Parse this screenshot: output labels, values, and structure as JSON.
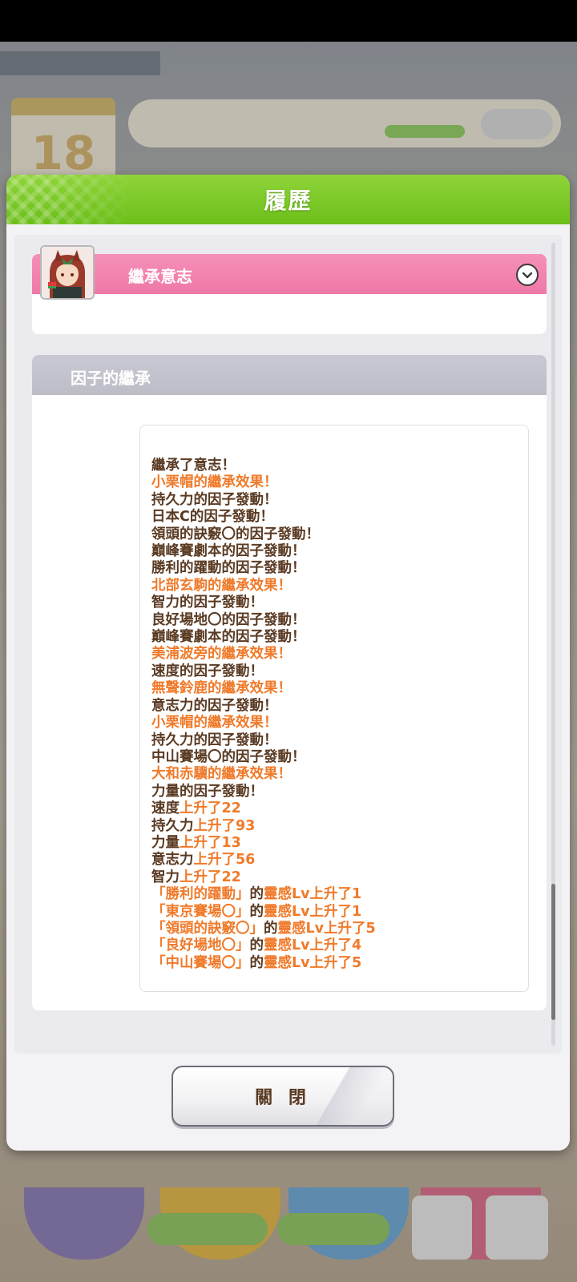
{
  "modal": {
    "title": "履歷",
    "close_label": "關 閉"
  },
  "card1": {
    "label": "繼承意志"
  },
  "card2": {
    "label": "因子的繼承"
  },
  "log": [
    [
      {
        "t": "繼承了意志！",
        "c": "d"
      }
    ],
    [
      {
        "t": "小栗帽的繼承效果！",
        "c": "o"
      }
    ],
    [
      {
        "t": "持久力的因子發動！",
        "c": "d"
      }
    ],
    [
      {
        "t": "日本C的因子發動！",
        "c": "d"
      }
    ],
    [
      {
        "t": "領頭的訣竅〇的因子發動！",
        "c": "d"
      }
    ],
    [
      {
        "t": "巔峰賽劇本的因子發動！",
        "c": "d"
      }
    ],
    [
      {
        "t": "勝利的躍動的因子發動！",
        "c": "d"
      }
    ],
    [
      {
        "t": "北部玄駒的繼承效果！",
        "c": "o"
      }
    ],
    [
      {
        "t": "智力的因子發動！",
        "c": "d"
      }
    ],
    [
      {
        "t": "良好場地〇的因子發動！",
        "c": "d"
      }
    ],
    [
      {
        "t": "巔峰賽劇本的因子發動！",
        "c": "d"
      }
    ],
    [
      {
        "t": "美浦波旁的繼承效果！",
        "c": "o"
      }
    ],
    [
      {
        "t": "速度的因子發動！",
        "c": "d"
      }
    ],
    [
      {
        "t": "無聲鈴鹿的繼承效果！",
        "c": "o"
      }
    ],
    [
      {
        "t": "意志力的因子發動！",
        "c": "d"
      }
    ],
    [
      {
        "t": "小栗帽的繼承效果！",
        "c": "o"
      }
    ],
    [
      {
        "t": "持久力的因子發動！",
        "c": "d"
      }
    ],
    [
      {
        "t": "中山賽場〇的因子發動！",
        "c": "d"
      }
    ],
    [
      {
        "t": "大和赤驥的繼承效果！",
        "c": "o"
      }
    ],
    [
      {
        "t": "力量的因子發動！",
        "c": "d"
      }
    ],
    [
      {
        "t": "速度",
        "c": "d"
      },
      {
        "t": "上升了22",
        "c": "o"
      }
    ],
    [
      {
        "t": "持久力",
        "c": "d"
      },
      {
        "t": "上升了93",
        "c": "o"
      }
    ],
    [
      {
        "t": "力量",
        "c": "d"
      },
      {
        "t": "上升了13",
        "c": "o"
      }
    ],
    [
      {
        "t": "意志力",
        "c": "d"
      },
      {
        "t": "上升了56",
        "c": "o"
      }
    ],
    [
      {
        "t": "智力",
        "c": "d"
      },
      {
        "t": "上升了22",
        "c": "o"
      }
    ],
    [
      {
        "t": "「勝利的躍動」",
        "c": "o"
      },
      {
        "t": "的",
        "c": "d"
      },
      {
        "t": "靈感Lv上升了1",
        "c": "o"
      }
    ],
    [
      {
        "t": "「東京賽場〇」",
        "c": "o"
      },
      {
        "t": "的",
        "c": "d"
      },
      {
        "t": "靈感Lv上升了1",
        "c": "o"
      }
    ],
    [
      {
        "t": "「領頭的訣竅〇」",
        "c": "o"
      },
      {
        "t": "的",
        "c": "d"
      },
      {
        "t": "靈感Lv上升了5",
        "c": "o"
      }
    ],
    [
      {
        "t": "「良好場地〇」",
        "c": "o"
      },
      {
        "t": "的",
        "c": "d"
      },
      {
        "t": "靈感Lv上升了4",
        "c": "o"
      }
    ],
    [
      {
        "t": "「中山賽場〇」",
        "c": "o"
      },
      {
        "t": "的",
        "c": "d"
      },
      {
        "t": "靈感Lv上升了5",
        "c": "o"
      }
    ]
  ],
  "background": {
    "calendar_day": "18"
  },
  "icons": {
    "chevron": "chevron-down-circle-icon",
    "avatar": "character-portrait"
  },
  "colors": {
    "header_green": "#7ac82a",
    "card_pink": "#f082ae",
    "card_gray": "#c3c3cd",
    "text_brown": "#5a3a22",
    "text_orange": "#f07a2a"
  }
}
